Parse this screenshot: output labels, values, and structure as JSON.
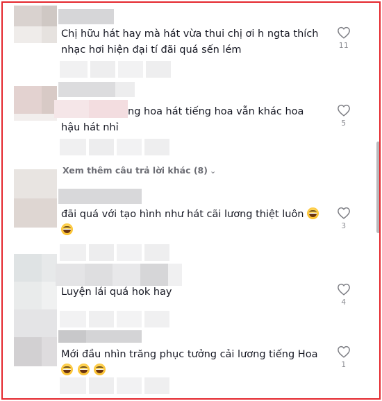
{
  "comments": [
    {
      "text": "Chị hữu hát hay mà hát vừa thui chị ơi h ngta thích nhạc hơi hiện đại tí đãi quá sến lém",
      "likes": "11",
      "emoji_count": 0
    },
    {
      "text": "ng hoa hát tiếng hoa vẫn khác hoa hậu hát nhỉ",
      "likes": "5",
      "emoji_count": 0
    },
    {
      "text": "đãi quá với tạo hình như hát cãi lương thiệt luôn",
      "likes": "3",
      "emoji_count": 2
    },
    {
      "text": "Luyện lái quá hok hay",
      "likes": "4",
      "emoji_count": 0
    },
    {
      "text": "Mới đầu nhìn trăng phục tưởng cải lương tiếng Hoa",
      "likes": "1",
      "emoji_count": 3
    }
  ],
  "replies": {
    "view_more_label": "Xem thêm câu trả lời khác (8)"
  },
  "icons": {
    "like": "heart-outline-icon",
    "expand": "chevron-down-icon",
    "emoji": "grinning-squinting-face-emoji"
  },
  "colors": {
    "border": "#e4262c",
    "text": "#161823",
    "muted": "#8a8b91"
  }
}
